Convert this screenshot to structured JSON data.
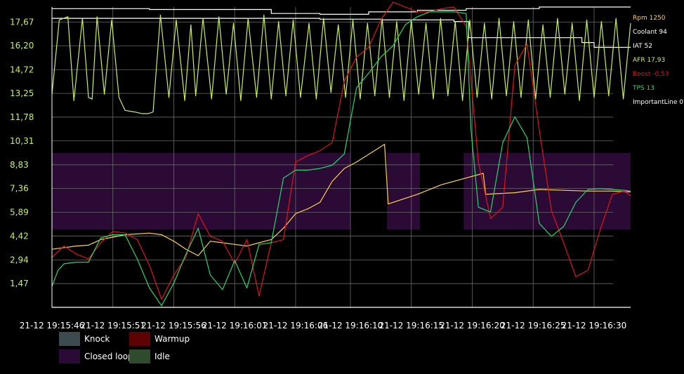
{
  "chart_data": {
    "type": "line",
    "y_tick_labels": [
      "17,67",
      "16,20",
      "14,72",
      "13,25",
      "11,78",
      "10,31",
      "8,83",
      "7,36",
      "5,89",
      "4,42",
      "2,94",
      "1,47"
    ],
    "y_tick_values": [
      17.67,
      16.2,
      14.72,
      13.25,
      11.78,
      10.31,
      8.83,
      7.36,
      5.89,
      4.42,
      2.94,
      1.47
    ],
    "ylim": [
      0,
      18.6
    ],
    "x_tick_labels": [
      "21-12 19:15:46",
      "21-12 19:15:51",
      "21-12 19:15:56",
      "21-12 19:16:01",
      "21-12 19:16:06",
      "21-12 19:16:10",
      "21-12 19:16:15",
      "21-12 19:16:20",
      "21-12 19:16:25",
      "21-12 19:16:30"
    ],
    "x_tick_seconds": [
      0,
      5,
      10,
      15,
      20,
      24.5,
      29.5,
      34.5,
      39.5,
      44.5
    ],
    "xlim": [
      0,
      47.5
    ],
    "grid": true,
    "closed_loop_bands": [
      [
        0,
        24.5
      ],
      [
        27.5,
        30.2
      ],
      [
        33.8,
        47.5
      ]
    ],
    "series": [
      {
        "name": "Rpm",
        "stat": "1250",
        "color": "#ffd24a",
        "x": [
          0,
          2,
          3,
          4,
          6,
          8,
          9,
          10,
          11,
          12,
          13,
          14,
          15,
          16,
          17,
          18,
          19,
          20,
          21,
          22,
          23,
          24,
          25,
          27.3,
          27.6,
          30,
          32,
          35.4,
          35.6,
          38,
          40,
          42,
          44,
          46,
          47.5
        ],
        "y": [
          3.6,
          3.8,
          3.85,
          4.2,
          4.5,
          4.6,
          4.5,
          4.1,
          3.6,
          3.2,
          4.1,
          4.0,
          3.9,
          3.8,
          4.0,
          4.2,
          4.9,
          5.8,
          6.1,
          6.5,
          7.8,
          8.6,
          9.0,
          10.1,
          6.4,
          7.0,
          7.6,
          8.3,
          7.0,
          7.1,
          7.3,
          7.25,
          7.2,
          7.2,
          7.15
        ]
      },
      {
        "name": "Coolant",
        "stat": "94",
        "color": "#ffffff",
        "x": [
          0,
          8,
          18,
          22,
          26,
          30,
          34,
          34.8,
          40,
          47.5
        ],
        "y": [
          18.5,
          18.45,
          18.2,
          18.15,
          18.3,
          18.4,
          18.5,
          18.5,
          18.6,
          18.6
        ]
      },
      {
        "name": "IAT",
        "stat": "52",
        "color": "#ffffff",
        "x": [
          0,
          10,
          15,
          22,
          27,
          33,
          34.2,
          40,
          43.5,
          44.5,
          47.5
        ],
        "y": [
          17.9,
          17.9,
          17.9,
          17.85,
          17.8,
          17.7,
          16.7,
          16.7,
          16.4,
          16.1,
          16.1
        ]
      },
      {
        "name": "AFR",
        "stat": "17,93",
        "color": "#c7f05a",
        "x": [
          0,
          0.6,
          1.3,
          1.8,
          2.5,
          3.0,
          3.3,
          3.7,
          4.3,
          4.9,
          5.5,
          6.0,
          6.8,
          7.4,
          7.9,
          8.3,
          8.9,
          9.6,
          10.2,
          10.9,
          11.4,
          11.8,
          12.4,
          13.1,
          13.7,
          14.3,
          14.9,
          15.5,
          16.1,
          16.8,
          17.4,
          18.0,
          18.6,
          19.2,
          19.8,
          20.4,
          21.1,
          21.7,
          22.3,
          22.9,
          23.5,
          24.1,
          24.7,
          25.3,
          25.9,
          26.5,
          27.1,
          27.7,
          28.3,
          28.9,
          29.5,
          30.1,
          30.7,
          31.3,
          31.9,
          32.5,
          33.1,
          33.7,
          34.3,
          34.9,
          35.5,
          36.1,
          36.7,
          37.3,
          37.9,
          38.5,
          39.1,
          39.7,
          40.3,
          40.9,
          41.5,
          42.1,
          42.7,
          43.3,
          43.9,
          44.5,
          45.1,
          45.7,
          46.3,
          46.9,
          47.5
        ],
        "y": [
          13.2,
          17.8,
          18.0,
          12.8,
          17.9,
          13.0,
          12.9,
          18.0,
          13.2,
          17.8,
          13.0,
          12.2,
          12.1,
          12.0,
          12.0,
          12.1,
          18.1,
          13.0,
          17.8,
          12.8,
          17.5,
          13.1,
          17.9,
          12.9,
          18.0,
          13.2,
          17.6,
          12.8,
          17.9,
          13.0,
          18.1,
          12.9,
          17.7,
          13.1,
          17.8,
          13.0,
          17.6,
          12.9,
          17.9,
          13.3,
          17.5,
          13.0,
          17.8,
          12.9,
          17.6,
          13.1,
          17.9,
          13.0,
          17.7,
          12.8,
          17.8,
          13.2,
          17.6,
          12.9,
          17.9,
          13.1,
          17.7,
          12.8,
          17.8,
          13.0,
          17.6,
          12.9,
          17.9,
          13.1,
          17.7,
          13.0,
          17.8,
          12.9,
          17.5,
          13.0,
          17.9,
          13.2,
          17.6,
          12.8,
          17.8,
          13.0,
          17.7,
          13.1,
          17.9,
          12.9,
          17.6
        ]
      },
      {
        "name": "Boost",
        "stat": "-0,53",
        "color": "#e01515",
        "x": [
          0,
          1,
          2,
          3,
          4,
          5,
          6,
          7,
          8,
          9,
          10,
          11,
          12,
          13,
          14,
          15,
          16,
          17,
          18,
          19,
          20,
          21,
          22,
          23,
          24,
          25,
          26,
          27,
          28,
          29,
          30,
          31,
          32,
          33,
          34,
          35,
          36,
          37,
          38,
          39,
          40,
          41,
          42,
          43,
          44,
          45,
          46,
          47,
          47.5
        ],
        "y": [
          3.1,
          3.8,
          3.3,
          3.0,
          4.0,
          4.7,
          4.6,
          4.2,
          2.6,
          0.5,
          2.0,
          3.1,
          5.8,
          4.4,
          4.1,
          2.7,
          4.2,
          0.7,
          4.0,
          4.2,
          9.0,
          9.4,
          9.7,
          10.2,
          14.0,
          15.5,
          16.1,
          17.8,
          18.9,
          18.6,
          18.3,
          18.3,
          18.5,
          18.6,
          17.4,
          9.0,
          5.5,
          6.2,
          15.0,
          16.3,
          11.0,
          6.0,
          4.0,
          1.9,
          2.3,
          4.8,
          7.0,
          7.2,
          6.9
        ]
      },
      {
        "name": "TPS",
        "stat": "13",
        "color": "#22d86a",
        "x": [
          0,
          0.5,
          1,
          2,
          3,
          4,
          5,
          6,
          7,
          8,
          9,
          10,
          11,
          12,
          13,
          14,
          15,
          16,
          17,
          18,
          19,
          20,
          21,
          22,
          23,
          24,
          25,
          26,
          27,
          28,
          29,
          30,
          31,
          32,
          33,
          34,
          34.4,
          35,
          36,
          37,
          38,
          39,
          40,
          41,
          42,
          43,
          44,
          45,
          46,
          47,
          47.5
        ],
        "y": [
          1.3,
          2.3,
          2.7,
          2.8,
          2.8,
          4.3,
          4.5,
          4.5,
          3.0,
          1.2,
          0.1,
          1.5,
          3.3,
          4.9,
          2.0,
          1.1,
          2.9,
          1.2,
          3.9,
          4.0,
          8.0,
          8.5,
          8.5,
          8.6,
          8.8,
          9.5,
          13.6,
          14.5,
          15.5,
          16.2,
          17.5,
          18.0,
          18.3,
          18.3,
          18.3,
          18.2,
          11.0,
          6.2,
          5.9,
          10.2,
          11.8,
          10.5,
          5.2,
          4.4,
          5.0,
          6.5,
          7.3,
          7.35,
          7.3,
          7.25,
          7.2
        ]
      }
    ],
    "important_line": {
      "name": "ImportantLine",
      "stat": "0",
      "color": "#ffffff"
    },
    "legend": [
      {
        "label": "Knock",
        "color": "#3d4a4e"
      },
      {
        "label": "Warmup",
        "color": "#5e0303"
      },
      {
        "label": "Closed loop",
        "color": "#2c0a36"
      },
      {
        "label": "Idle",
        "color": "#2f4a2c"
      }
    ],
    "band_color": "#2c0a36",
    "grid_color": "#6a6a6a"
  }
}
